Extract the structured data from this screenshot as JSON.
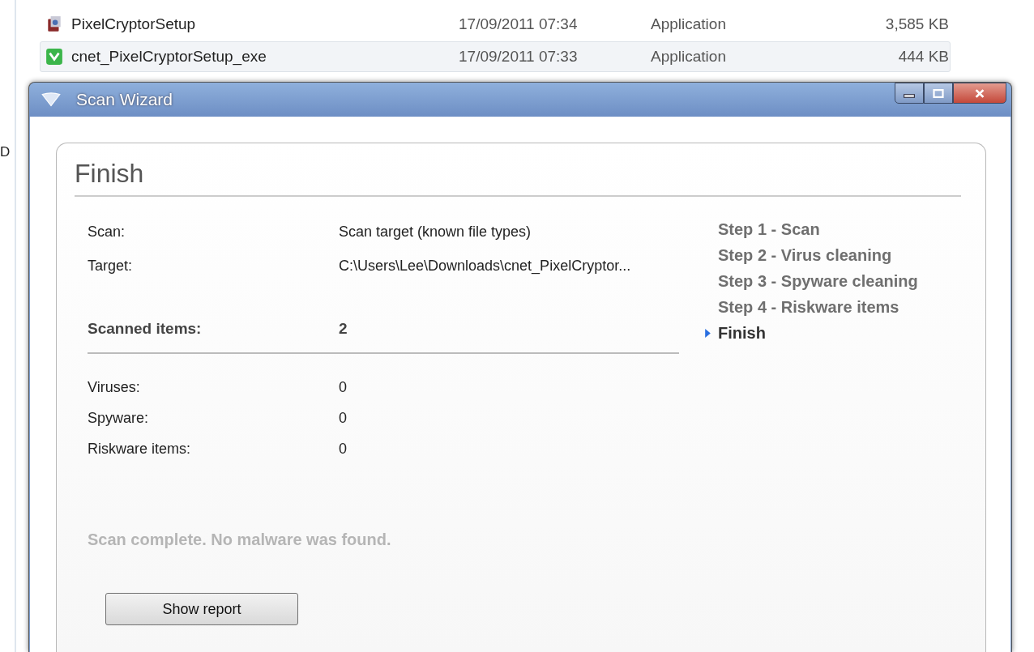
{
  "explorer": {
    "edge_letter": "D",
    "files": [
      {
        "name": "PixelCryptorSetup",
        "date": "17/09/2011 07:34",
        "type": "Application",
        "size": "3,585 KB",
        "selected": false,
        "kind": "setup"
      },
      {
        "name": "cnet_PixelCryptorSetup_exe",
        "date": "17/09/2011 07:33",
        "type": "Application",
        "size": "444 KB",
        "selected": true,
        "kind": "cnet"
      }
    ]
  },
  "window": {
    "title": "Scan Wizard"
  },
  "page": {
    "heading": "Finish",
    "details": [
      {
        "label": "Scan:",
        "value": "Scan target (known file types)"
      },
      {
        "label": "Target:",
        "value": "C:\\Users\\Lee\\Downloads\\cnet_PixelCryptor..."
      }
    ],
    "summary": {
      "label": "Scanned items:",
      "value": "2"
    },
    "counts": [
      {
        "label": "Viruses:",
        "value": "0"
      },
      {
        "label": "Spyware:",
        "value": "0"
      },
      {
        "label": "Riskware items:",
        "value": "0"
      }
    ],
    "message": "Scan complete. No malware was found.",
    "button": "Show report"
  },
  "steps": [
    {
      "label": "Step 1 - Scan",
      "selected": false
    },
    {
      "label": "Step 2 - Virus cleaning",
      "selected": false
    },
    {
      "label": "Step 3 - Spyware cleaning",
      "selected": false
    },
    {
      "label": "Step 4 - Riskware items",
      "selected": false
    },
    {
      "label": "Finish",
      "selected": true
    }
  ]
}
